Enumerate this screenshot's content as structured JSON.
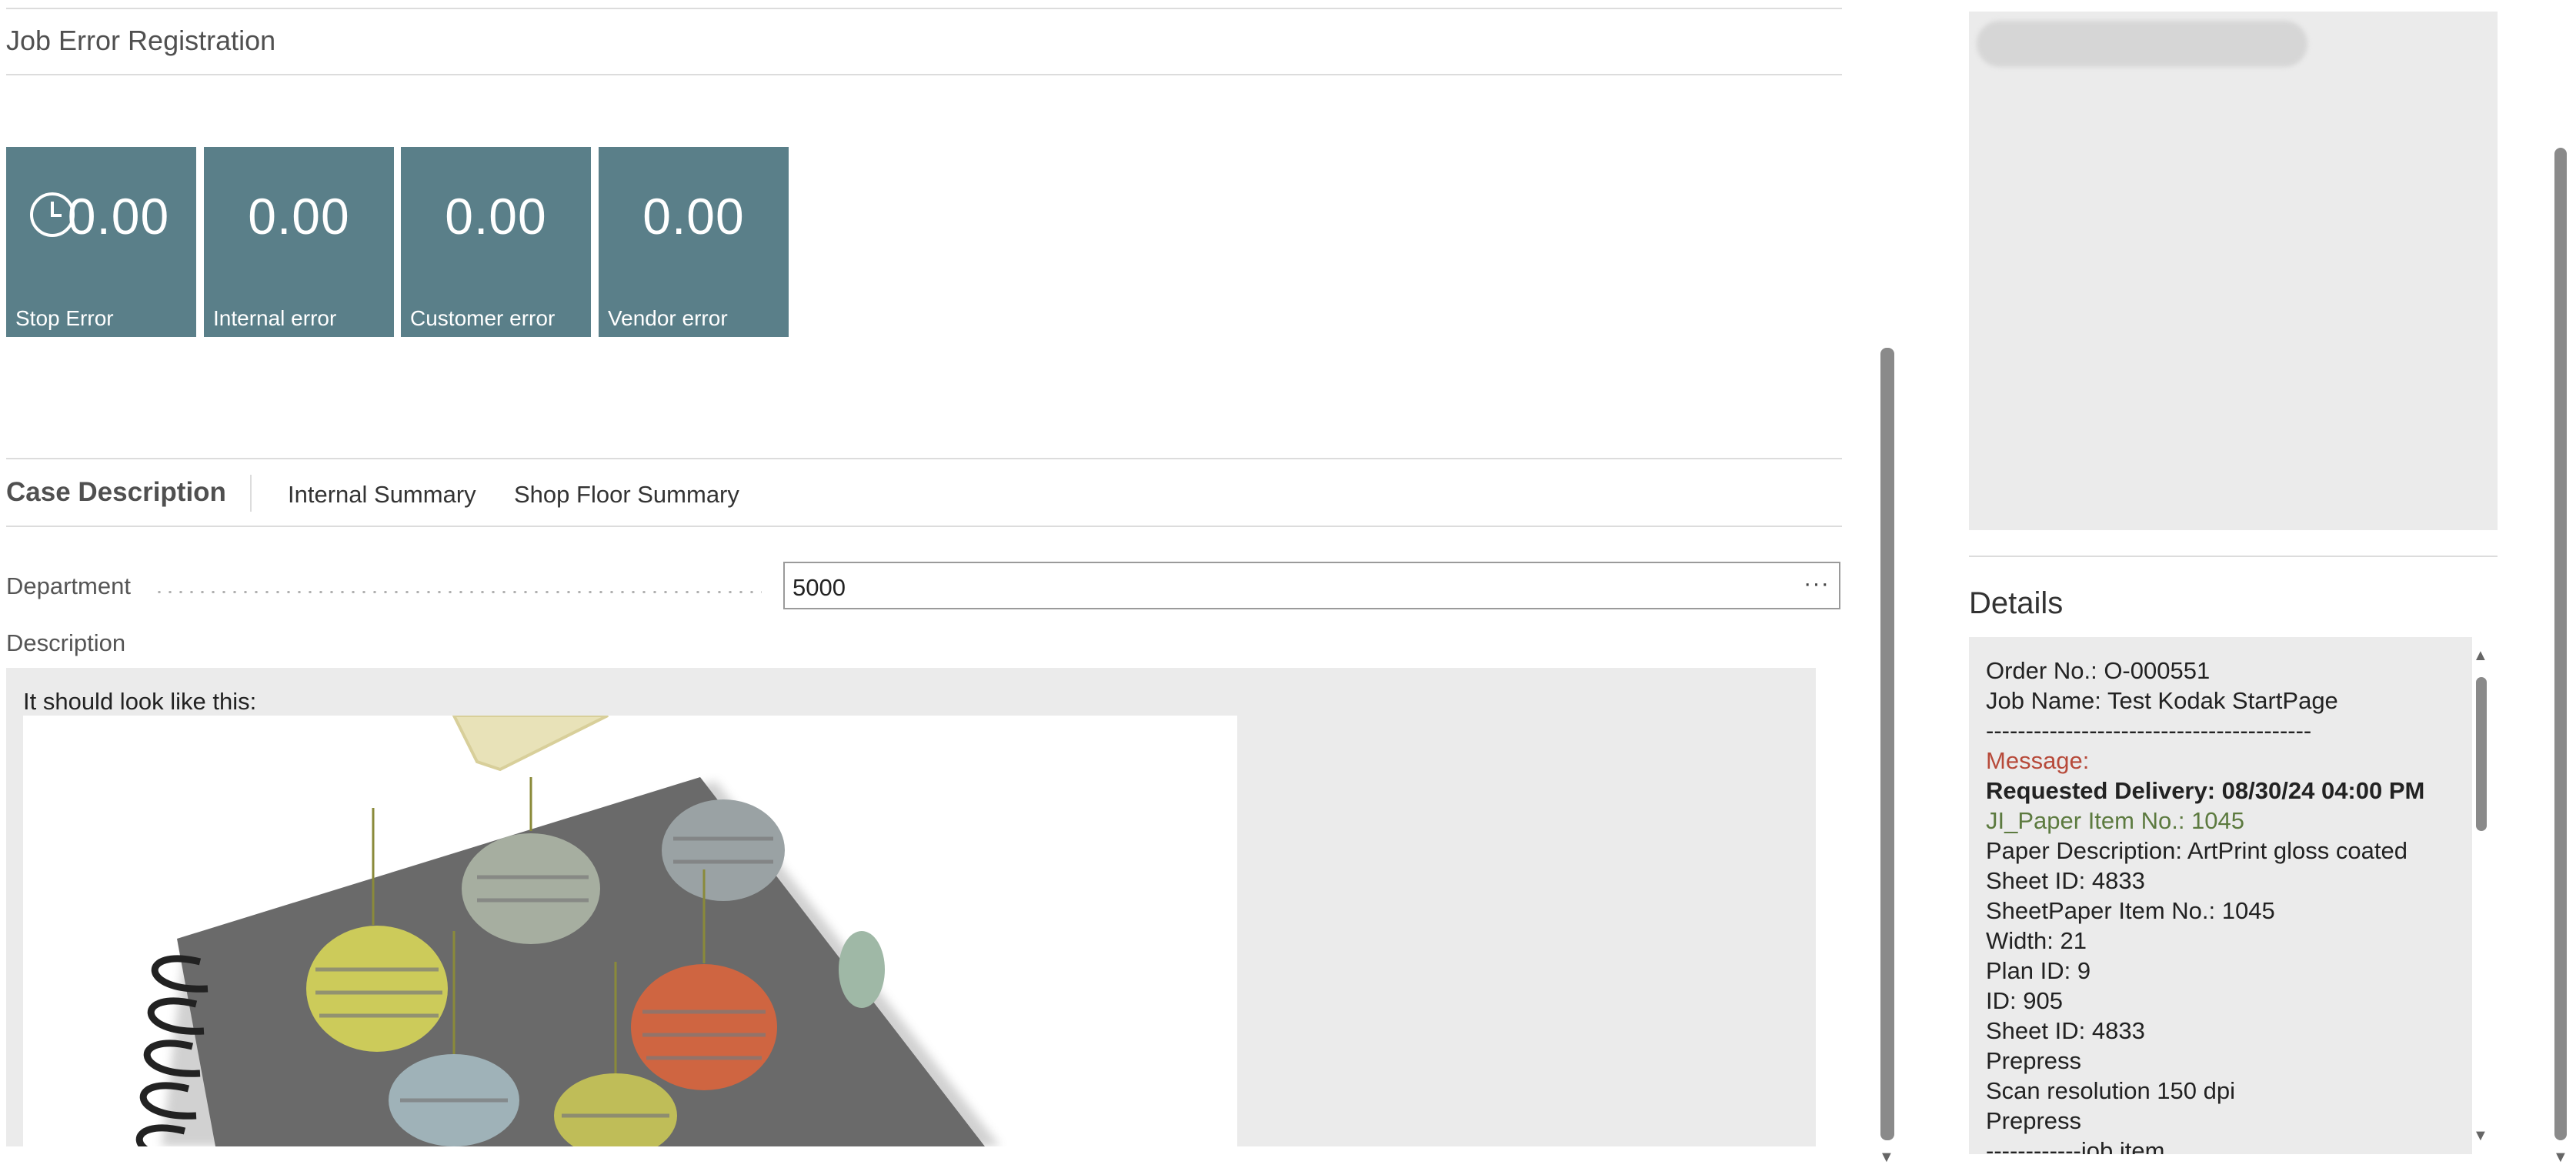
{
  "section": {
    "title": "Job Error Registration"
  },
  "tiles": [
    {
      "value": "0.00",
      "label": "Stop Error",
      "icon": "clock-icon"
    },
    {
      "value": "0.00",
      "label": "Internal error"
    },
    {
      "value": "0.00",
      "label": "Customer error"
    },
    {
      "value": "0.00",
      "label": "Vendor error"
    }
  ],
  "tabs": [
    "Case Description",
    "Internal Summary",
    "Shop Floor Summary"
  ],
  "department": {
    "label": "Department",
    "value": "5000",
    "more": "···"
  },
  "description": {
    "label": "Description",
    "text": "It should look like this:"
  },
  "details": {
    "title": "Details",
    "lines": [
      "Order No.: O-000551",
      "Job Name: Test Kodak StartPage",
      "-----------------------------------------",
      "Message:",
      "Requested Delivery: 08/30/24 04:00 PM",
      "JI_Paper Item No.: 1045",
      "Paper Description: ArtPrint gloss coated",
      "Sheet ID: 4833",
      "SheetPaper Item No.: 1045",
      "Width: 21",
      "Plan ID: 9",
      "ID: 905",
      "Sheet ID: 4833",
      "Prepress",
      "Scan resolution 150 dpi",
      "Prepress",
      "------------job item"
    ]
  },
  "colors": {
    "tile": "#5a7f89",
    "message": "#b74a3a",
    "paper_item": "#5c7a3f",
    "panel_bg": "#ebebeb"
  }
}
